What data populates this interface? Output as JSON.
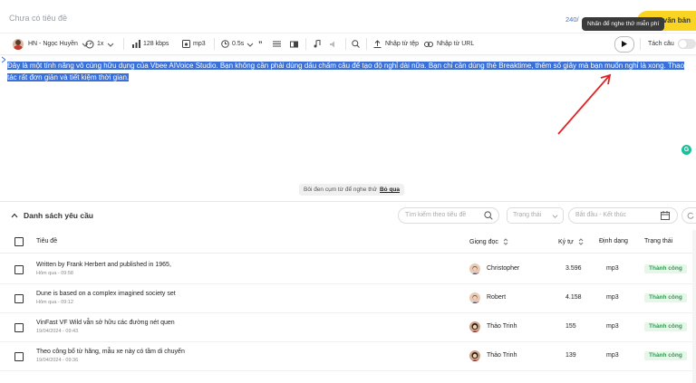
{
  "header": {
    "title_placeholder": "Chưa có tiêu đề",
    "char_counter": "240/",
    "tooltip": "Nhấn để nghe thử miễn phí",
    "convert_button": "văn bản"
  },
  "toolbar": {
    "voice": "HN - Ngọc Huyền",
    "speed": "1x",
    "bitrate": "128 kbps",
    "format": "mp3",
    "pause": "0.5s",
    "import_file": "Nhập từ tệp",
    "import_url": "Nhập từ URL",
    "split_sentence": "Tách câu"
  },
  "editor": {
    "text": "Đây là một tính năng vô cùng hữu dụng của Vbee AIVoice Studio. Bạn không cần phải dùng dấu chấm câu để tạo độ nghỉ dài nữa. Bạn chỉ cần dùng thẻ Breaktime, thêm số giây mà bạn muốn nghỉ là xong. Thao tác rất đơn giản và tiết kiệm thời gian."
  },
  "hint": {
    "text": "Bôi đen cụm từ để nghe thử",
    "skip": "Bỏ qua"
  },
  "requests": {
    "title": "Danh sách yêu cầu",
    "search_placeholder": "Tìm kiếm theo tiêu đề",
    "status_placeholder": "Trạng thái",
    "date_placeholder": "Bắt đầu - Kết thúc",
    "columns": [
      "Tiêu đề",
      "Giọng đọc",
      "Ký tự",
      "Định dạng",
      "Trạng thái"
    ],
    "rows": [
      {
        "title": "Written by Frank Herbert and published in 1965,",
        "time": "Hôm qua - 09:58",
        "voice": "Christopher",
        "chars": "3.596",
        "format": "mp3",
        "status": "Thành công",
        "avatar": "male"
      },
      {
        "title": "Dune is based on a complex imagined society set",
        "time": "Hôm qua - 09:12",
        "voice": "Robert",
        "chars": "4.158",
        "format": "mp3",
        "status": "Thành công",
        "avatar": "male"
      },
      {
        "title": "VinFast VF Wild vẫn sở hữu các đường nét quen",
        "time": "19/04/2024 - 09:43",
        "voice": "Thảo Trinh",
        "chars": "155",
        "format": "mp3",
        "status": "Thành công",
        "avatar": "female"
      },
      {
        "title": "Theo công bố từ hãng, mẫu xe này có tầm di chuyển",
        "time": "19/04/2024 - 09:36",
        "voice": "Thảo Trinh",
        "chars": "139",
        "format": "mp3",
        "status": "Thành công",
        "avatar": "female"
      }
    ]
  },
  "colors": {
    "accent_yellow": "#f9d423",
    "selection_blue": "#3a70d8",
    "success_green": "#2e9e4f",
    "arrow_red": "#e02424"
  }
}
